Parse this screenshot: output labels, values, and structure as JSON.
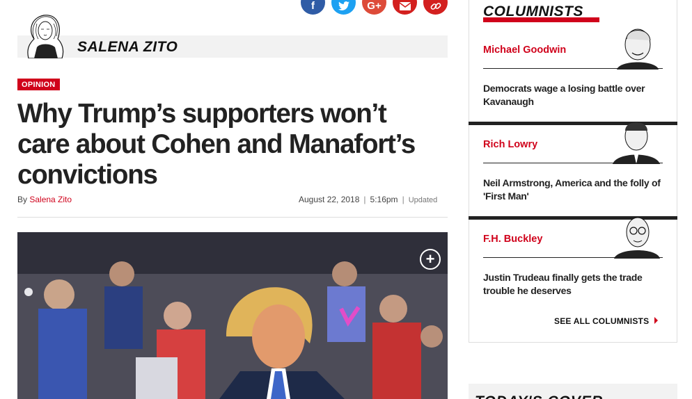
{
  "share": {
    "facebook": "f",
    "twitter": "t",
    "googleplus": "G+",
    "email": "✉",
    "link": "🔗"
  },
  "author": {
    "name": "SALENA ZITO"
  },
  "article": {
    "section": "OPINION",
    "headline": "Why Trump’s supporters won’t care about Cohen and Manafort’s convictions",
    "by_prefix": "By",
    "author_link": "Salena Zito",
    "date": "August 22, 2018",
    "time": "5:16pm",
    "updated": "Updated",
    "separator": "|"
  },
  "sidebar": {
    "title": "COLUMNISTS",
    "columnists": [
      {
        "name": "Michael Goodwin",
        "story": "Democrats wage a losing battle over Kavanaugh"
      },
      {
        "name": "Rich Lowry",
        "story": "Neil Armstrong, America and the folly of 'First Man'"
      },
      {
        "name": "F.H. Buckley",
        "story": "Justin Trudeau finally gets the trade trouble he deserves"
      }
    ],
    "see_all": "SEE ALL COLUMNISTS",
    "cover_title": "TODAY'S COVER"
  },
  "colors": {
    "accent": "#d0021b",
    "facebook": "#2f5ca6",
    "twitter": "#1da1f2",
    "googleplus": "#dd4b39"
  }
}
